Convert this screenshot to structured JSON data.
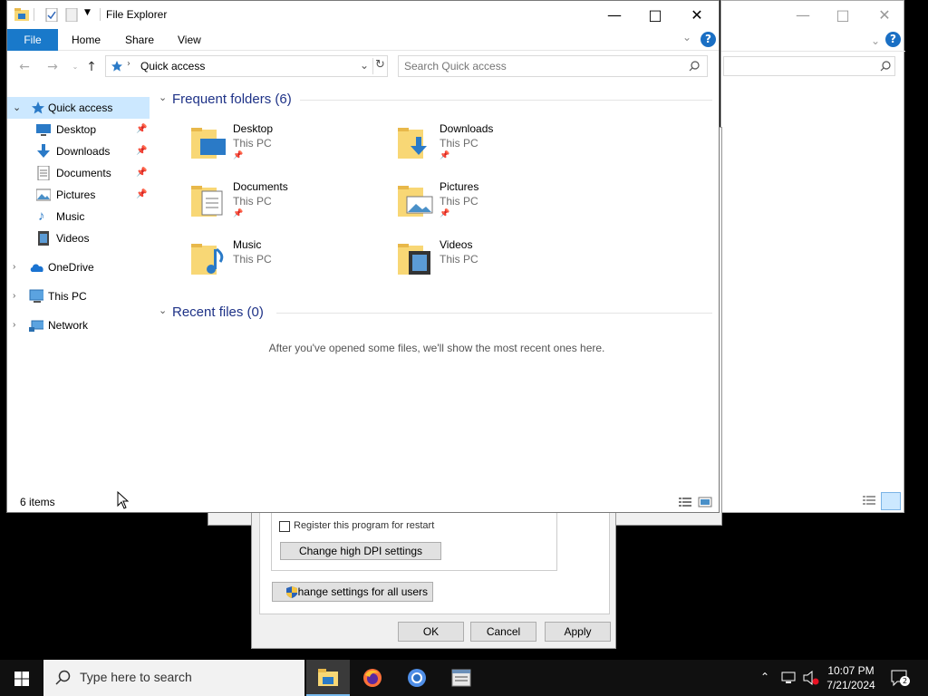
{
  "explorer": {
    "title": "File Explorer",
    "ribbon_tabs": [
      "File",
      "Home",
      "Share",
      "View"
    ],
    "address": "Quick access",
    "search_placeholder": "Search Quick access",
    "sidebar": [
      {
        "label": "Quick access",
        "icon": "star-icon",
        "selected": true,
        "pinned": false
      },
      {
        "label": "Desktop",
        "icon": "desktop-icon",
        "pinned": true
      },
      {
        "label": "Downloads",
        "icon": "download-icon",
        "pinned": true
      },
      {
        "label": "Documents",
        "icon": "document-icon",
        "pinned": true
      },
      {
        "label": "Pictures",
        "icon": "pictures-icon",
        "pinned": true
      },
      {
        "label": "Music",
        "icon": "music-icon",
        "pinned": false
      },
      {
        "label": "Videos",
        "icon": "videos-icon",
        "pinned": false
      },
      {
        "label": "OneDrive",
        "icon": "cloud-icon",
        "pinned": false
      },
      {
        "label": "This PC",
        "icon": "computer-icon",
        "pinned": false
      },
      {
        "label": "Network",
        "icon": "network-icon",
        "pinned": false
      }
    ],
    "frequent_header": "Frequent folders (6)",
    "frequent_folders": [
      {
        "name": "Desktop",
        "location": "This PC",
        "pinned": true
      },
      {
        "name": "Downloads",
        "location": "This PC",
        "pinned": true
      },
      {
        "name": "Documents",
        "location": "This PC",
        "pinned": true
      },
      {
        "name": "Pictures",
        "location": "This PC",
        "pinned": true
      },
      {
        "name": "Music",
        "location": "This PC",
        "pinned": false
      },
      {
        "name": "Videos",
        "location": "This PC",
        "pinned": false
      }
    ],
    "recent_header": "Recent files (0)",
    "recent_message": "After you've opened some files, we'll show the most recent ones here.",
    "status": "6 items"
  },
  "properties_dialog": {
    "register_restart": "Register this program for restart",
    "dpi_button": "Change high DPI settings",
    "all_users_button": "Change settings for all users",
    "ok": "OK",
    "cancel": "Cancel",
    "apply": "Apply"
  },
  "taskbar": {
    "search_placeholder": "Type here to search",
    "time": "10:07 PM",
    "date": "7/21/2024",
    "notification_count": "2"
  },
  "colors": {
    "accent": "#1979ca",
    "selection": "#cce8ff",
    "section_header": "#1e3287",
    "folder_yellow": "#f8d775"
  }
}
